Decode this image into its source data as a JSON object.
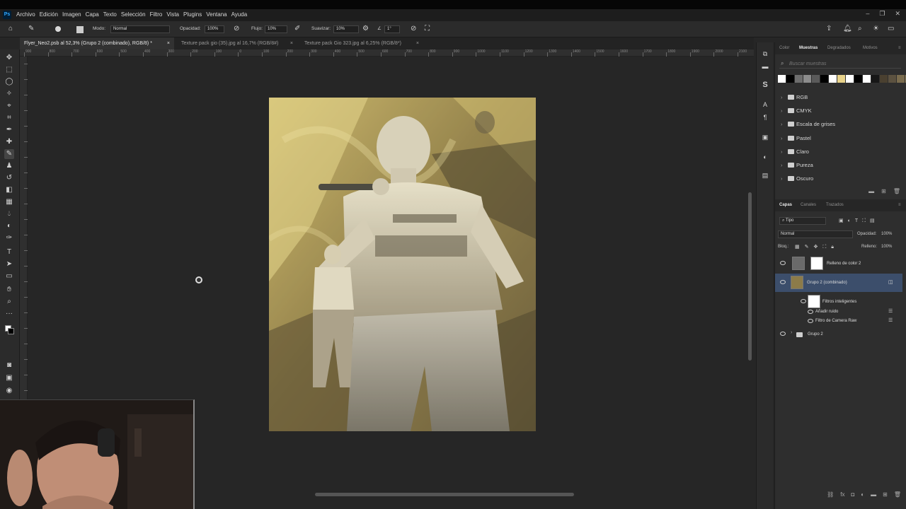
{
  "menubar": {
    "app_icon": "Ps",
    "items": [
      "Archivo",
      "Edición",
      "Imagen",
      "Capa",
      "Texto",
      "Selección",
      "Filtro",
      "Vista",
      "Plugins",
      "Ventana",
      "Ayuda"
    ]
  },
  "options": {
    "mode_label": "Modo:",
    "mode_value": "Normal",
    "opacity_label": "Opacidad:",
    "opacity_value": "100%",
    "flow_label": "Flujo:",
    "flow_value": "10%",
    "smooth_label": "Suavizar:",
    "smooth_value": "10%",
    "angle_value": "1°",
    "brush_size": "67"
  },
  "tabs": [
    {
      "label": "Flyer_Neo2.psb al 52,3% (Grupo 2 (combinado), RGB/8) *",
      "active": true
    },
    {
      "label": "Texture pack gio (35).jpg al 16,7% (RGB/8#)",
      "active": false
    },
    {
      "label": "Texture pack Gio 323.jpg al 6,25% (RGB/8*)",
      "active": false
    }
  ],
  "ruler_numbers": [
    "900",
    "800",
    "700",
    "600",
    "500",
    "400",
    "300",
    "200",
    "100",
    "0",
    "100",
    "200",
    "300",
    "400",
    "500",
    "600",
    "700",
    "800",
    "900",
    "1000",
    "1100",
    "1200",
    "1300",
    "1400",
    "1500",
    "1600",
    "1700",
    "1800",
    "1900",
    "2000",
    "2100"
  ],
  "swatches_panel": {
    "tabs": [
      "Color",
      "Muestras",
      "Degradados",
      "Motivos"
    ],
    "active_tab": "Muestras",
    "search_placeholder": "Buscar muestras",
    "colors": [
      "#ffffff",
      "#000000",
      "#6e6e6e",
      "#8c8c8c",
      "#5a5a5a",
      "#000000",
      "#ffffff",
      "#e9d38a",
      "#ffffff",
      "#000000",
      "#ffffff",
      "#171717",
      "#4a4030",
      "#5c5240",
      "#7a6c4e",
      "#8e7d56",
      "#e7c96c",
      "#c9b072"
    ],
    "folders": [
      "RGB",
      "CMYK",
      "Escala de grises",
      "Pastel",
      "Claro",
      "Pureza",
      "Oscuro"
    ]
  },
  "layers_panel": {
    "tabs": [
      "Capas",
      "Canales",
      "Trazados"
    ],
    "active_tab": "Capas",
    "filter_label": "Tipo",
    "blend_mode": "Normal",
    "opacity_label": "Opacidad:",
    "opacity_value": "100%",
    "lock_label": "Bloq.:",
    "fill_label": "Relleno:",
    "fill_value": "100%",
    "layers": [
      {
        "name": "Relleno de color 2"
      },
      {
        "name": "Grupo 2 (combinado)"
      },
      {
        "name": "Filtros inteligentes"
      },
      {
        "name": "Añadir ruido"
      },
      {
        "name": "Filtro de Camera Raw"
      },
      {
        "name": "Grupo 2"
      }
    ]
  }
}
